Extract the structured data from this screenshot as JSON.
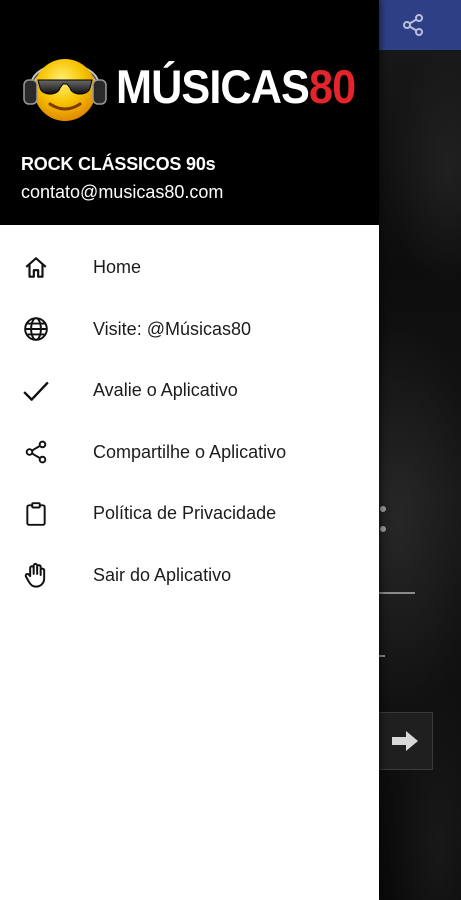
{
  "logo": {
    "text_main": "MÚSICAS",
    "text_accent": "80",
    "accent_color": "#e3242b"
  },
  "header": {
    "title": "ROCK CLÁSSICOS 90s",
    "email": "contato@musicas80.com"
  },
  "menu": {
    "items": [
      {
        "label": "Home",
        "icon": "home-icon"
      },
      {
        "label": "Visite: @Músicas80",
        "icon": "globe-icon"
      },
      {
        "label": "Avalie o Aplicativo",
        "icon": "check-icon"
      },
      {
        "label": "Compartilhe o Aplicativo",
        "icon": "share-icon"
      },
      {
        "label": "Política de Privacidade",
        "icon": "clipboard-icon"
      },
      {
        "label": "Sair do Aplicativo",
        "icon": "hand-icon"
      }
    ]
  },
  "background_app": {
    "toolbar_color": "#2f3f86",
    "toolbar_icon": "share-icon",
    "next_button_icon": "arrow-right-icon"
  }
}
